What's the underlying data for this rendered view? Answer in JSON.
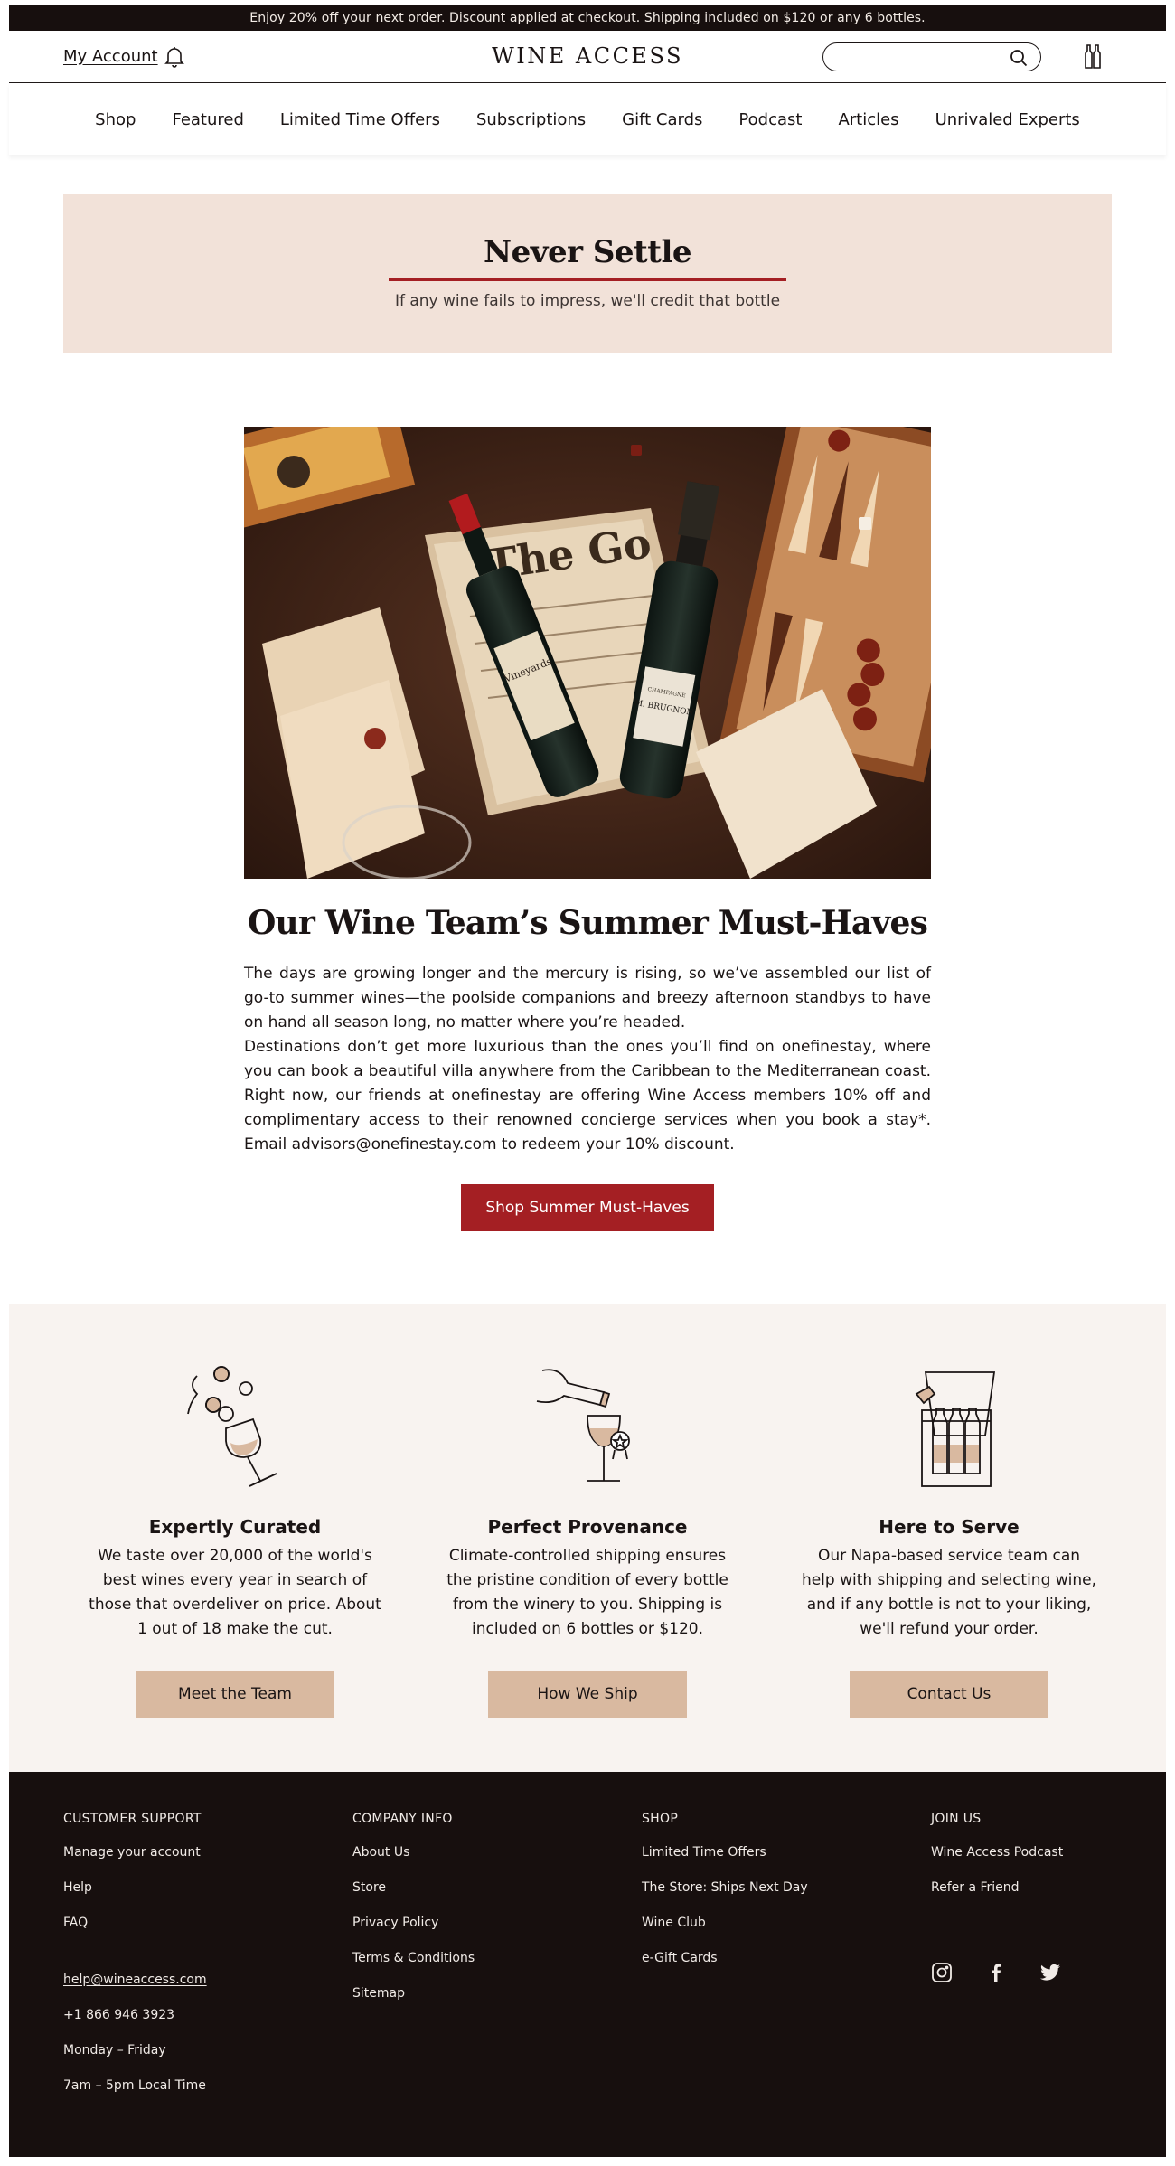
{
  "promo_bar": {
    "text": "Enjoy 20% off your next order. Discount applied at checkout. Shipping included on $120 or any 6 bottles."
  },
  "header": {
    "account_label": "My Account",
    "logo_text": "WINE ACCESS",
    "search_placeholder": "",
    "icons": [
      "bell-icon",
      "search-icon",
      "cart-icon"
    ]
  },
  "nav": {
    "items": [
      {
        "label": "Shop"
      },
      {
        "label": "Featured"
      },
      {
        "label": "Limited Time Offers"
      },
      {
        "label": "Subscriptions"
      },
      {
        "label": "Gift Cards"
      },
      {
        "label": "Podcast"
      },
      {
        "label": "Articles"
      },
      {
        "label": "Unrivaled Experts"
      }
    ]
  },
  "banner": {
    "title": "Never Settle",
    "subtitle": "If any wine fails to impress, we'll credit that bottle",
    "accent_color": "#a41f23",
    "background_color": "#f2e2d9"
  },
  "article": {
    "title": "Our Wine Team’s Summer Must-Haves",
    "paragraphs": [
      "The days are growing longer and the mercury is rising, so we’ve assembled our list of go-to summer wines—the poolside companions and breezy afternoon standbys to have on hand all season long, no matter where you’re headed.",
      "Destinations don’t get more luxurious than the ones you’ll find on onefinestay, where you can book a beautiful villa anywhere from the Caribbean to the Mediterranean coast. Right now, our friends at onefinestay are offering Wine Access members 10% off and complimentary access to their renowned concierge services when you book a stay*. Email advisors@onefinestay.com to redeem your 10% discount."
    ],
    "cta_label": "Shop Summer Must-Haves",
    "cta_color": "#a41f23",
    "image_labels": {
      "champagne_brand": "M. BRUGNON",
      "champagne_type": "CHAMPAGNE",
      "newspaper": "The Go"
    }
  },
  "values": [
    {
      "icon": "wine-glass-icon",
      "title": "Expertly Curated",
      "text": "We taste over 20,000 of the world's best wines every year in search of those that overdeliver on price. About 1 out of 18 make the cut.",
      "button": "Meet the Team"
    },
    {
      "icon": "pouring-bottle-icon",
      "title": "Perfect Provenance",
      "text": "Climate-controlled shipping ensures the pristine condition of every bottle from the winery to you. Shipping is included on 6 bottles or $120.",
      "button": "How We Ship"
    },
    {
      "icon": "wine-box-icon",
      "title": "Here to Serve",
      "text": "Our Napa-based service team can help with shipping and selecting wine, and if any bottle is not to your liking, we'll refund your order.",
      "button": "Contact Us"
    }
  ],
  "footer": {
    "support": {
      "heading": "CUSTOMER SUPPORT",
      "links": [
        "Manage your account",
        "Help",
        "FAQ"
      ],
      "email": "help@wineaccess.com",
      "phone": "+1 866 946 3923",
      "days": "Monday – Friday",
      "hours": "7am – 5pm Local Time"
    },
    "company": {
      "heading": "COMPANY INFO",
      "links": [
        "About Us",
        "Store",
        "Privacy Policy",
        "Terms & Conditions",
        "Sitemap"
      ]
    },
    "shop": {
      "heading": "SHOP",
      "links": [
        "Limited Time Offers",
        "The Store: Ships Next Day",
        "Wine Club",
        "e-Gift Cards"
      ]
    },
    "join": {
      "heading": "JOIN US",
      "links": [
        "Wine Access Podcast",
        "Refer a Friend"
      ],
      "social": [
        "instagram-icon",
        "facebook-icon",
        "twitter-icon"
      ]
    }
  }
}
